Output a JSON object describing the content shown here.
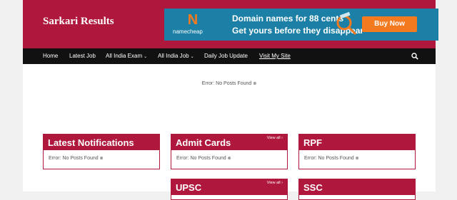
{
  "header": {
    "site_title": "Sarkari Results",
    "bg_color": "#b0173d"
  },
  "ad": {
    "brand_icon": "namecheap-n-logo",
    "brand_name": "namecheap",
    "line1": "Domain names for 88 cents",
    "line2": "Get yours before they disappear",
    "button_label": "Buy Now",
    "bg_color": "#1c7fa6",
    "button_color": "#f47a20"
  },
  "nav": {
    "items": [
      {
        "label": "Home",
        "dropdown": false
      },
      {
        "label": "Latest Job",
        "dropdown": false
      },
      {
        "label": "All India Exam",
        "dropdown": true
      },
      {
        "label": "All India Job",
        "dropdown": true
      },
      {
        "label": "Daily Job Update",
        "dropdown": false
      },
      {
        "label": "Visit My Site",
        "dropdown": false
      }
    ],
    "caret_glyph": "⌄",
    "search_icon": "search-icon"
  },
  "main": {
    "error_text": "Error: No Posts Found",
    "error_icon": "⊗"
  },
  "widgets": [
    {
      "title": "Latest Notifications",
      "view_all": "",
      "error": "Error: No Posts Found"
    },
    {
      "title": "Admit Cards",
      "view_all": "View all ›",
      "error": "Error: No Posts Found"
    },
    {
      "title": "RPF",
      "view_all": "",
      "error": "Error: No Posts Found"
    },
    {
      "title": "UPSC",
      "view_all": "View all ›",
      "error": ""
    },
    {
      "title": "SSC",
      "view_all": "",
      "error": ""
    }
  ]
}
